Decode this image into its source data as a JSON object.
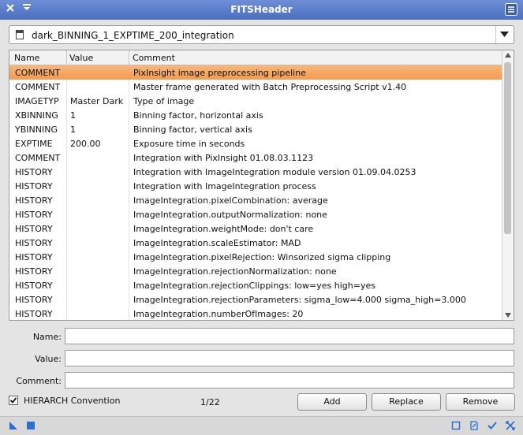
{
  "window": {
    "title": "FITSHeader"
  },
  "image_select": {
    "value": "dark_BINNING_1_EXPTIME_200_integration"
  },
  "table": {
    "headers": [
      "Name",
      "Value",
      "Comment"
    ],
    "rows": [
      {
        "name": "COMMENT",
        "value": "",
        "comment": "PixInsight image preprocessing pipeline"
      },
      {
        "name": "COMMENT",
        "value": "",
        "comment": "Master frame generated with Batch Preprocessing Script v1.40"
      },
      {
        "name": "IMAGETYP",
        "value": "Master Dark",
        "comment": "Type of image"
      },
      {
        "name": "XBINNING",
        "value": "1",
        "comment": "Binning factor, horizontal axis"
      },
      {
        "name": "YBINNING",
        "value": "1",
        "comment": "Binning factor, vertical axis"
      },
      {
        "name": "EXPTIME",
        "value": "200.00",
        "comment": "Exposure time in seconds"
      },
      {
        "name": "COMMENT",
        "value": "",
        "comment": "Integration with PixInsight 01.08.03.1123"
      },
      {
        "name": "HISTORY",
        "value": "",
        "comment": "Integration with ImageIntegration module version 01.09.04.0253"
      },
      {
        "name": "HISTORY",
        "value": "",
        "comment": "Integration with ImageIntegration process"
      },
      {
        "name": "HISTORY",
        "value": "",
        "comment": "ImageIntegration.pixelCombination: average"
      },
      {
        "name": "HISTORY",
        "value": "",
        "comment": "ImageIntegration.outputNormalization: none"
      },
      {
        "name": "HISTORY",
        "value": "",
        "comment": "ImageIntegration.weightMode: don't care"
      },
      {
        "name": "HISTORY",
        "value": "",
        "comment": "ImageIntegration.scaleEstimator: MAD"
      },
      {
        "name": "HISTORY",
        "value": "",
        "comment": "ImageIntegration.pixelRejection: Winsorized sigma clipping"
      },
      {
        "name": "HISTORY",
        "value": "",
        "comment": "ImageIntegration.rejectionNormalization: none"
      },
      {
        "name": "HISTORY",
        "value": "",
        "comment": "ImageIntegration.rejectionClippings: low=yes high=yes"
      },
      {
        "name": "HISTORY",
        "value": "",
        "comment": "ImageIntegration.rejectionParameters: sigma_low=4.000 sigma_high=3.000"
      },
      {
        "name": "HISTORY",
        "value": "",
        "comment": "ImageIntegration.numberOfImages: 20"
      }
    ]
  },
  "form": {
    "name_label": "Name:",
    "name_value": "",
    "value_label": "Value:",
    "value_value": "",
    "comment_label": "Comment:",
    "comment_value": ""
  },
  "footer": {
    "hierarch_label": "HIERARCH Convention",
    "hierarch_checked": true,
    "counter": "1/22",
    "add_label": "Add",
    "replace_label": "Replace",
    "remove_label": "Remove"
  },
  "colors": {
    "selection": "#f39a4e",
    "titlebar": "#4a6fc0",
    "icon_blue": "#2a6fd6"
  }
}
